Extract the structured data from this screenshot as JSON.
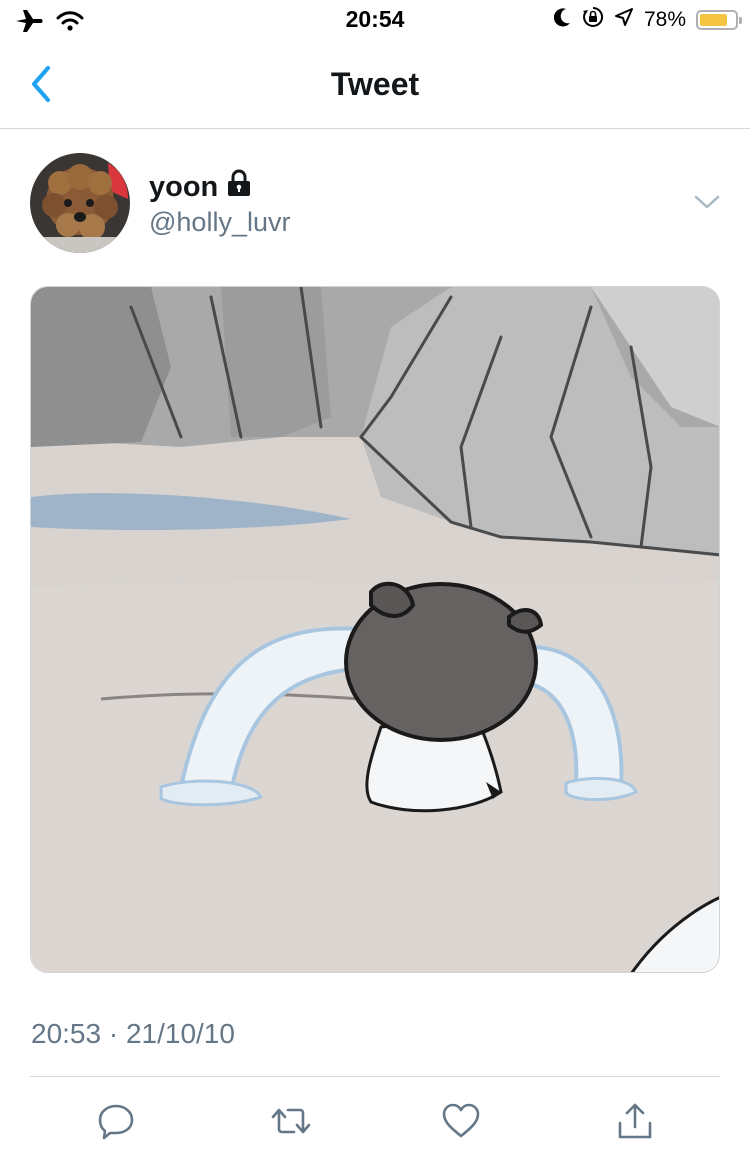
{
  "status_bar": {
    "time": "20:54",
    "battery_percent": "78%",
    "battery_level": 0.78,
    "left_icons": [
      "airplane-icon",
      "wifi-icon"
    ],
    "right_icons": [
      "moon-icon",
      "rotation-lock-icon",
      "location-icon"
    ]
  },
  "nav": {
    "title": "Tweet",
    "back_icon": "chevron-left-icon"
  },
  "tweet": {
    "display_name": "yoon",
    "handle": "@holly_luvr",
    "protected_icon": "lock-icon",
    "menu_icon": "chevron-down-icon",
    "timestamp": "20:53 · 21/10/10"
  },
  "actions": [
    "reply-icon",
    "retweet-icon",
    "like-icon",
    "share-icon"
  ],
  "colors": {
    "accent": "#1da1f2",
    "secondary_text": "#657786",
    "divider": "#d6d9db"
  }
}
